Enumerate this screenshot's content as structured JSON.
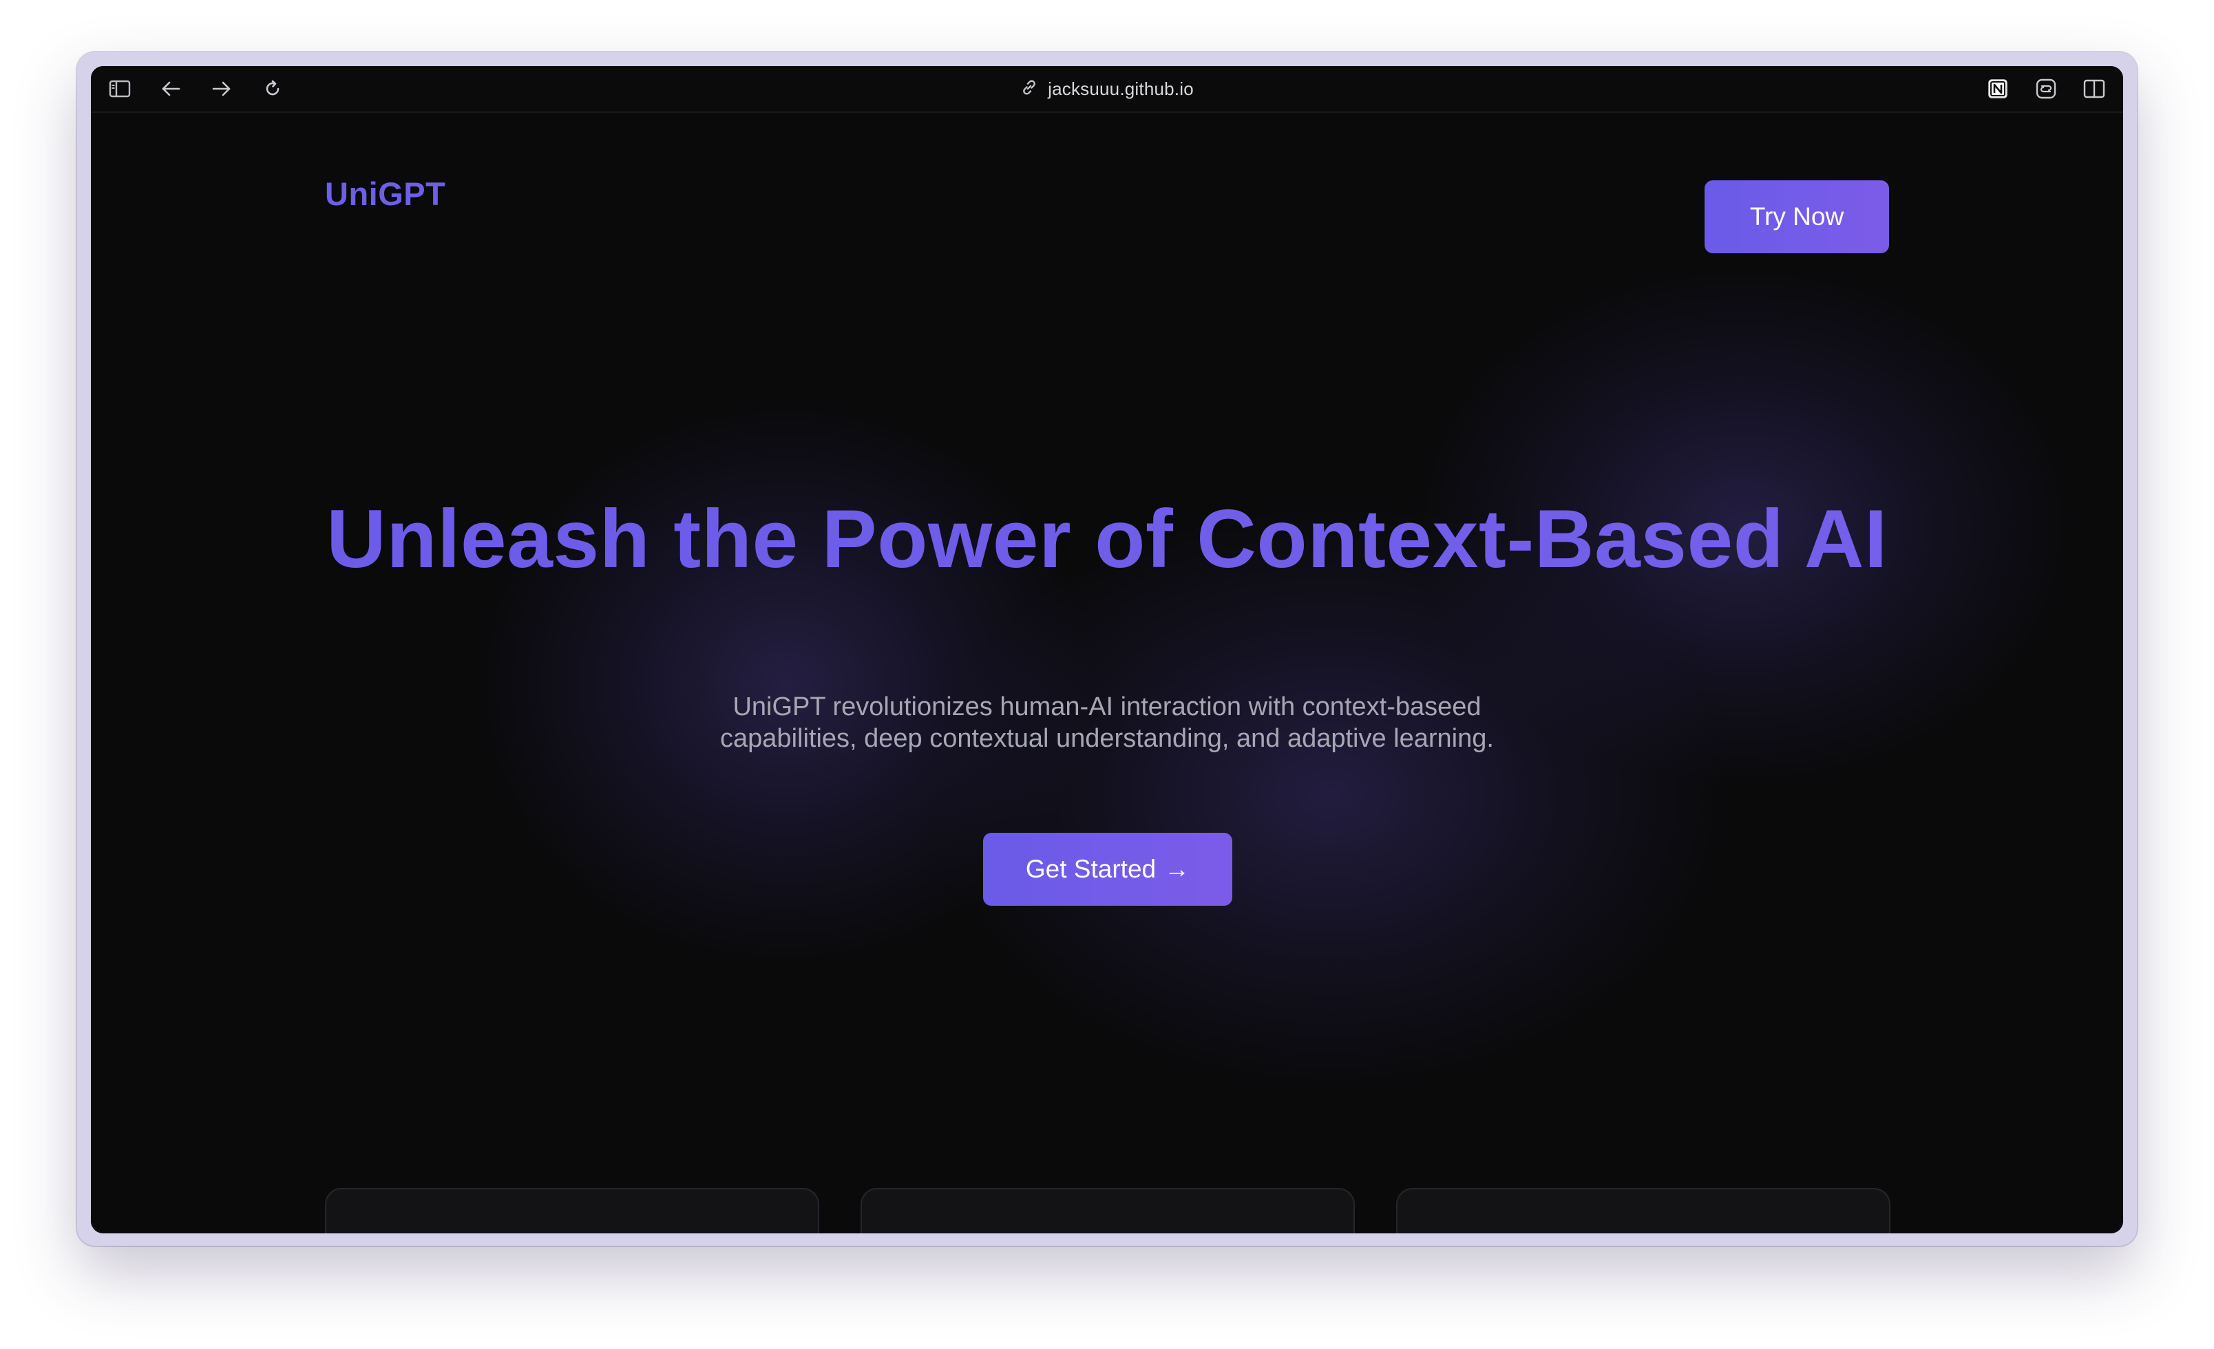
{
  "browser": {
    "address": "jacksuuu.github.io",
    "icons": {
      "sidebar": "sidebar-icon",
      "back": "arrow-left-icon",
      "forward": "arrow-right-icon",
      "reload": "reload-icon",
      "link": "link-icon",
      "notion": "notion-icon",
      "extension": "extension-icon",
      "split_view": "split-view-icon"
    }
  },
  "site": {
    "logo": "UniGPT",
    "nav": {
      "try_now_label": "Try Now"
    },
    "hero": {
      "title": "Unleash the Power of Context-Based AI",
      "subtitle": "UniGPT revolutionizes human-AI interaction with context-baseed capabilities, deep contextual understanding, and adaptive learning.",
      "cta_label": "Get Started",
      "cta_arrow": "→"
    },
    "colors": {
      "accent": "#6c5fe6",
      "accent_2": "#7b5ce8",
      "background": "#0a0a0b",
      "subtitle": "#a7a7b4"
    }
  }
}
